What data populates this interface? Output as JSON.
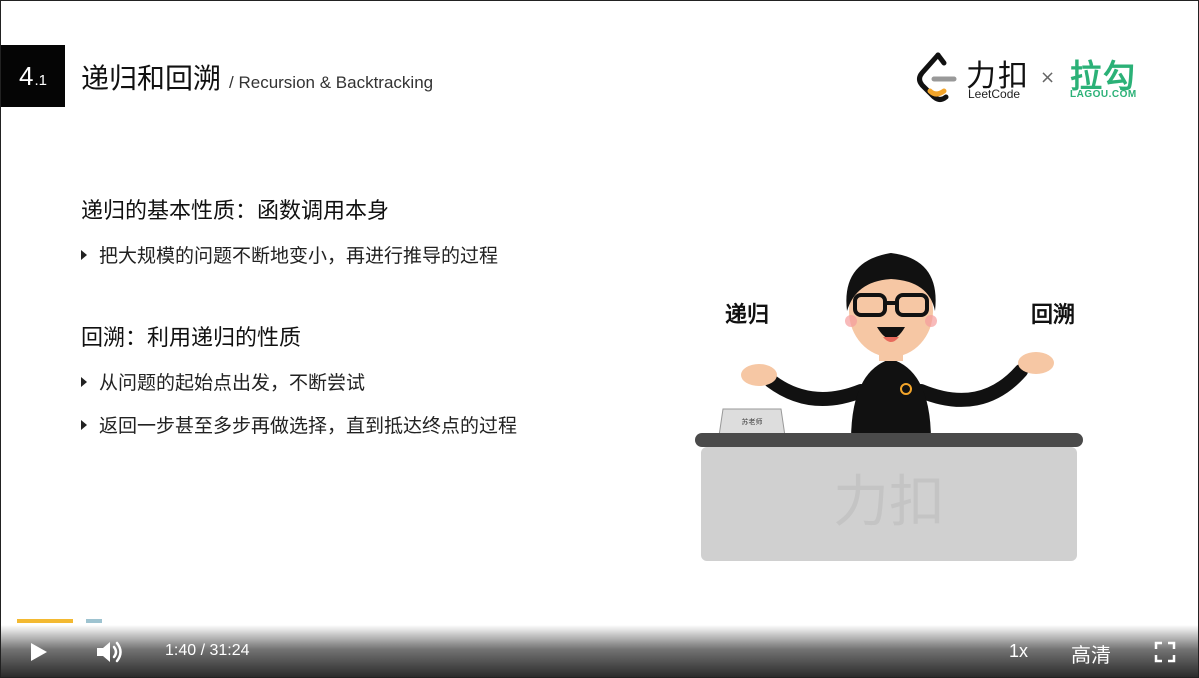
{
  "slide": {
    "number_main": "4",
    "number_sub": ".1",
    "title_cn": "递归和回溯",
    "title_en": "/ Recursion & Backtracking",
    "section1": {
      "heading": "递归的基本性质：函数调用本身",
      "bullets": [
        "把大规模的问题不断地变小，再进行推导的过程"
      ]
    },
    "section2": {
      "heading": "回溯：利用递归的性质",
      "bullets": [
        "从问题的起始点出发，不断尝试",
        "返回一步甚至多步再做选择，直到抵达终点的过程"
      ]
    },
    "illustration": {
      "label_left": "递归",
      "label_right": "回溯",
      "desk_watermark": "力扣",
      "nameplate": "苏老师"
    }
  },
  "logos": {
    "leetcode_cn": "力扣",
    "leetcode_en": "LeetCode",
    "separator": "×",
    "lagou_cn": "拉勾",
    "lagou_en": "LAGOU.COM"
  },
  "player": {
    "current_time": "1:40",
    "duration": "31:24",
    "time_display": "1:40 / 31:24",
    "speed": "1x",
    "quality": "高清",
    "progress_fraction": 0.053
  },
  "colors": {
    "leetcode_orange": "#f3a52b",
    "lagou_green": "#2bb177",
    "progress_played": "#f3b932",
    "progress_buffer": "#9ec3d0"
  },
  "icons": [
    "play-icon",
    "volume-icon",
    "fullscreen-icon",
    "leetcode-logo-icon"
  ]
}
